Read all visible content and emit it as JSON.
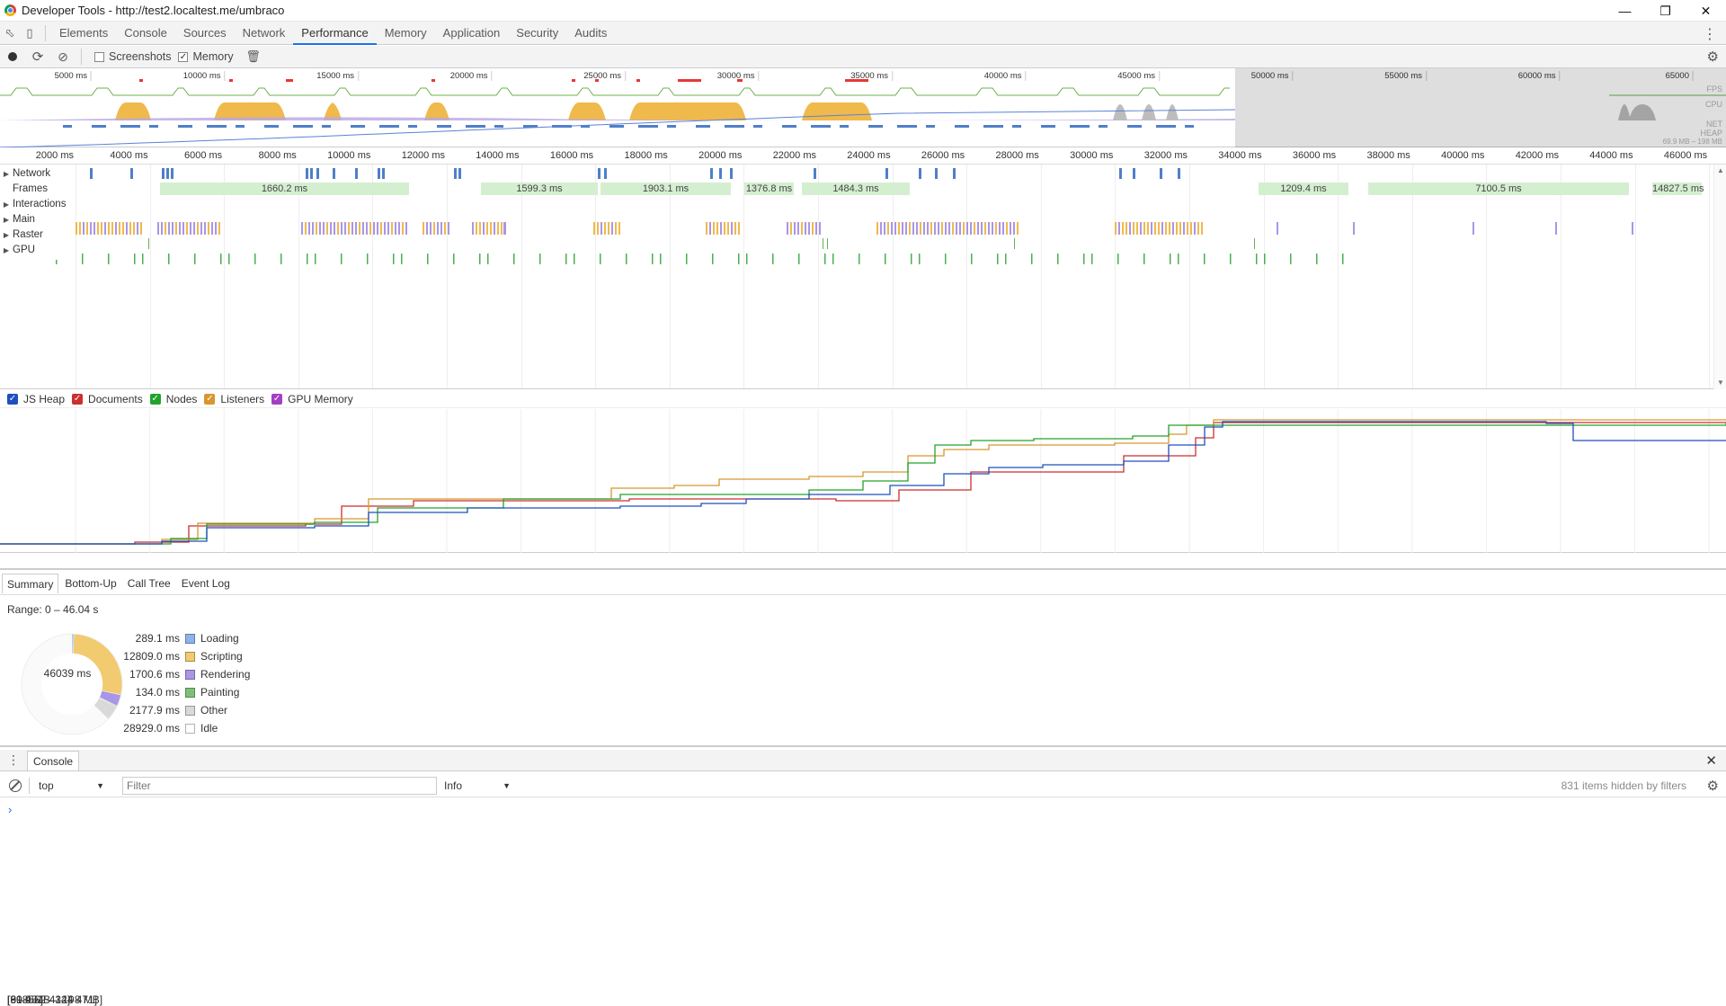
{
  "window": {
    "title": "Developer Tools - http://test2.localtest.me/umbraco"
  },
  "tabs": [
    "Elements",
    "Console",
    "Sources",
    "Network",
    "Performance",
    "Memory",
    "Application",
    "Security",
    "Audits"
  ],
  "active_tab": "Performance",
  "toolbar": {
    "screenshots_label": "Screenshots",
    "memory_label": "Memory"
  },
  "overview": {
    "ticks": [
      "5000 ms",
      "10000 ms",
      "15000 ms",
      "20000 ms",
      "25000 ms",
      "30000 ms",
      "35000 ms",
      "40000 ms",
      "45000 ms",
      "50000 ms",
      "55000 ms",
      "60000 ms",
      "65000"
    ],
    "labels": {
      "fps": "FPS",
      "cpu": "CPU",
      "net": "NET",
      "heap": "HEAP",
      "heap_range": "69.9 MB – 198 MB"
    }
  },
  "ruler": {
    "ticks": [
      "2000 ms",
      "4000 ms",
      "6000 ms",
      "8000 ms",
      "10000 ms",
      "12000 ms",
      "14000 ms",
      "16000 ms",
      "18000 ms",
      "20000 ms",
      "22000 ms",
      "24000 ms",
      "26000 ms",
      "28000 ms",
      "30000 ms",
      "32000 ms",
      "34000 ms",
      "36000 ms",
      "38000 ms",
      "40000 ms",
      "42000 ms",
      "44000 ms",
      "46000 ms"
    ]
  },
  "tracks": {
    "network": "Network",
    "frames": "Frames",
    "interactions": "Interactions",
    "main": "Main",
    "raster": "Raster",
    "gpu": "GPU"
  },
  "frames": [
    "1660.2 ms",
    "1599.3 ms",
    "1903.1 ms",
    "1376.8 ms",
    "1484.3 ms",
    "1209.4 ms",
    "7100.5 ms",
    "14827.5 ms"
  ],
  "counters": [
    {
      "range": "[69.9 MB – 198 MB]",
      "name": "JS Heap",
      "color": "#1f4fbf"
    },
    {
      "range": "[9 – 55]",
      "name": "Documents",
      "color": "#cc2f2f"
    },
    {
      "range": "[30 451 – 144 471]",
      "name": "Nodes",
      "color": "#21a32b"
    },
    {
      "range": "[618 – 2 432]",
      "name": "Listeners",
      "color": "#d8962e"
    },
    {
      "range": "",
      "name": "GPU Memory",
      "color": "#a33fc2"
    }
  ],
  "subtabs": [
    "Summary",
    "Bottom-Up",
    "Call Tree",
    "Event Log"
  ],
  "active_subtab": "Summary",
  "range_text": "Range: 0 – 46.04 s",
  "summary": {
    "total": "46039 ms",
    "items": [
      {
        "value": "289.1 ms",
        "label": "Loading",
        "color": "#8fb3e8",
        "ms": 289.1
      },
      {
        "value": "12809.0 ms",
        "label": "Scripting",
        "color": "#f2ca6f",
        "ms": 12809.0
      },
      {
        "value": "1700.6 ms",
        "label": "Rendering",
        "color": "#a996e6",
        "ms": 1700.6
      },
      {
        "value": "134.0 ms",
        "label": "Painting",
        "color": "#7fc077",
        "ms": 134.0
      },
      {
        "value": "2177.9 ms",
        "label": "Other",
        "color": "#d9d9d9",
        "ms": 2177.9
      },
      {
        "value": "28929.0 ms",
        "label": "Idle",
        "color": "#ffffff",
        "ms": 28929.0
      }
    ]
  },
  "drawer": {
    "tab": "Console",
    "context": "top",
    "filter_placeholder": "Filter",
    "level": "Info",
    "hidden": "831 items hidden by filters"
  }
}
